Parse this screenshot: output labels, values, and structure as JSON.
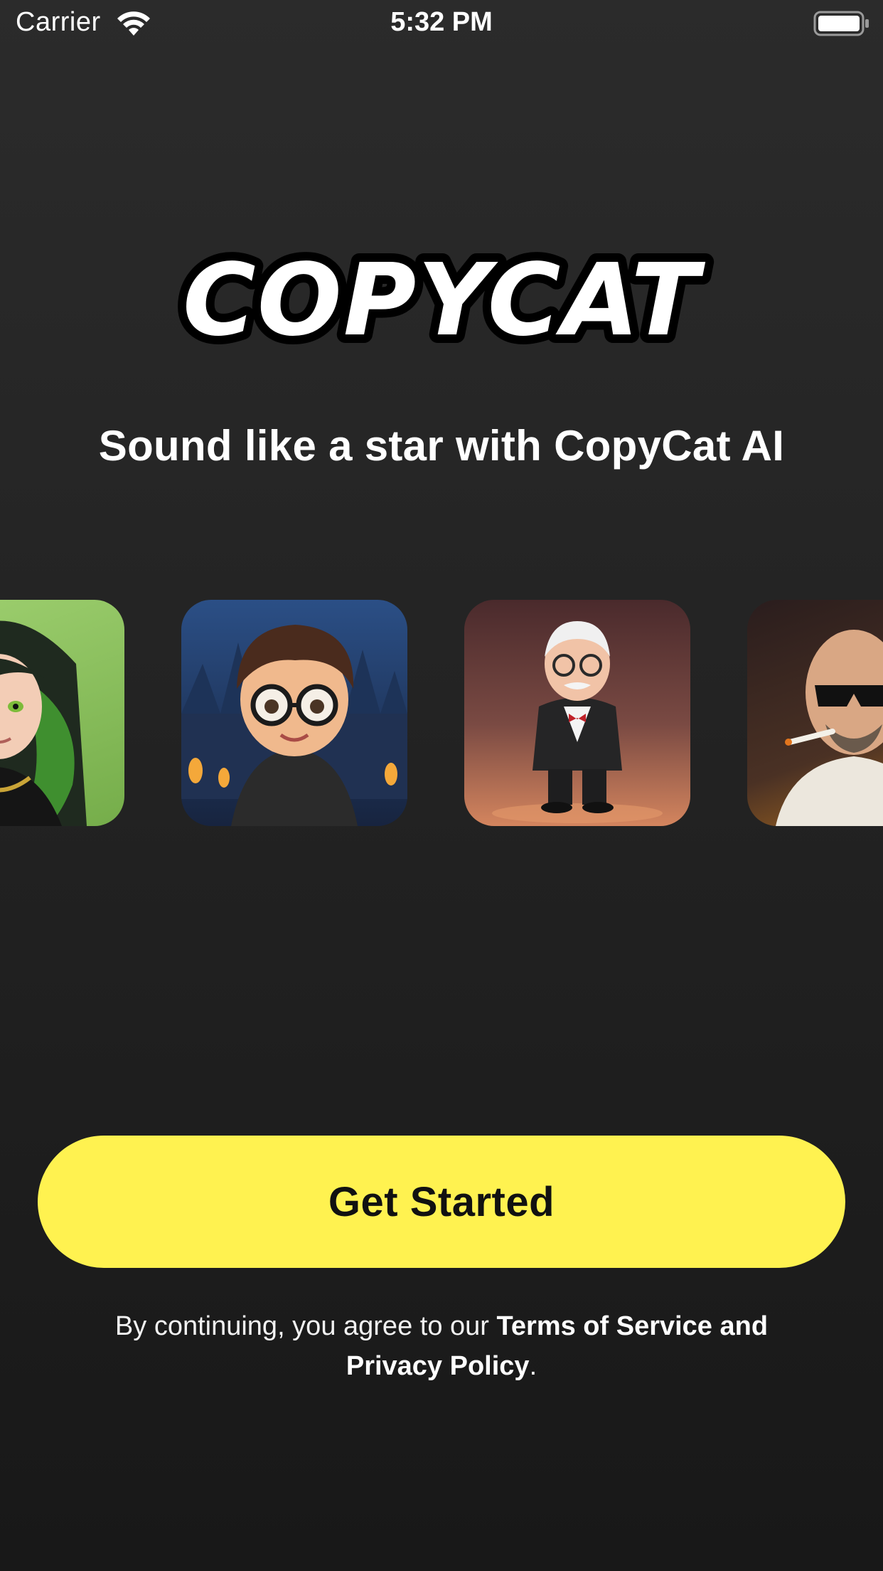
{
  "status_bar": {
    "carrier": "Carrier",
    "time": "5:32 PM",
    "icons": [
      "wifi-icon",
      "battery-icon"
    ]
  },
  "brand": {
    "logo_text": "COPYCAT"
  },
  "tagline": "Sound like a star with CopyCat AI",
  "carousel": {
    "avatars": [
      {
        "name": "avatar-green-hair-girl",
        "bg": "#8cc35c"
      },
      {
        "name": "avatar-boy-with-glasses",
        "bg": "#22375f"
      },
      {
        "name": "avatar-old-man-tuxedo",
        "bg": "#6a3d3a"
      },
      {
        "name": "avatar-bald-man-sunglasses",
        "bg": "#3b2820"
      }
    ]
  },
  "cta": {
    "label": "Get Started",
    "color": "#fff250"
  },
  "legal": {
    "prefix": "By continuing, you agree to our ",
    "terms": "Terms of Service",
    "and": " and ",
    "privacy": "Privacy Policy",
    "suffix": "."
  }
}
